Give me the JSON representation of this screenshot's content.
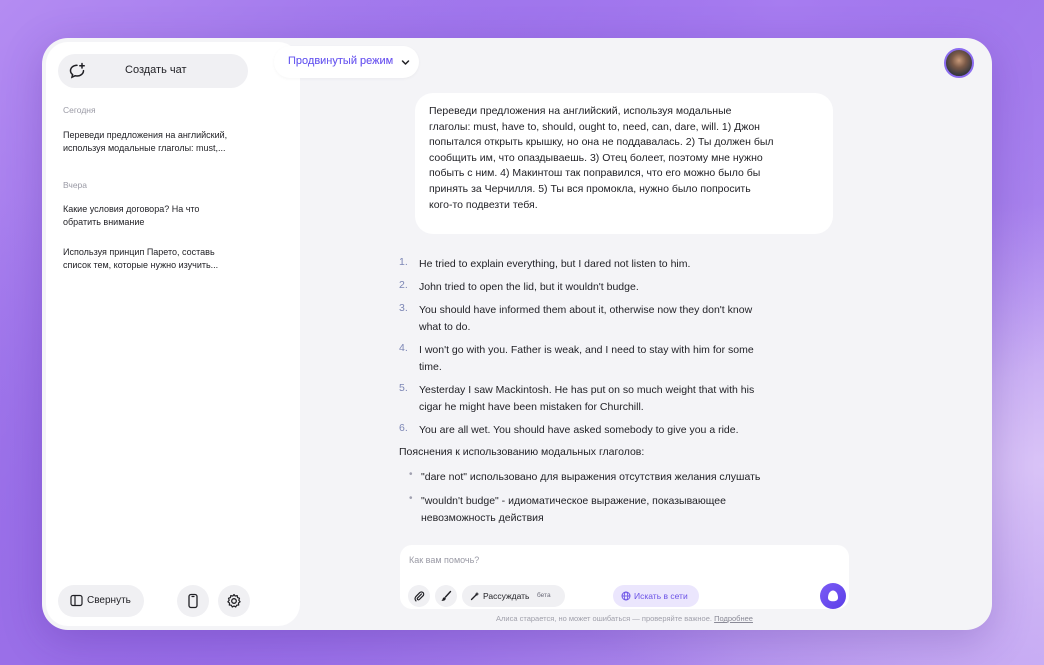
{
  "sidebar": {
    "new_chat_label": "Создать чат",
    "today_label": "Сегодня",
    "yesterday_label": "Вчера",
    "today_items": [
      {
        "line1": "Переведи предложения на английский,",
        "line2": "используя модальные глаголы: must,..."
      }
    ],
    "yesterday_items": [
      {
        "line1": "Какие условия договора? На что",
        "line2": "обратить внимание"
      },
      {
        "line1": "Используя принцип Парето, составь",
        "line2": "список тем, которые нужно изучить..."
      }
    ],
    "collapse_label": "Свернуть"
  },
  "header": {
    "mode_label": "Продвинутый режим"
  },
  "chat": {
    "user_message_lines": [
      "Переведи предложения на английский, используя модальные",
      "глаголы: must, have to, should, ought to, need, can, dare, will. 1) Джон",
      "попытался открыть крышку, но она не поддавалась. 2) Ты должен был",
      "сообщить им, что опаздываешь. 3) Отец болеет, поэтому мне нужно",
      "побыть с ним. 4) Макинтош так поправился, что его можно было бы",
      "принять за Черчилля. 5) Ты вся промокла, нужно было попросить",
      "кого-то подвезти тебя."
    ],
    "answer_list": [
      {
        "num": "1.",
        "line1": "He tried to explain everything, but I dared not listen to him.",
        "line2": ""
      },
      {
        "num": "2.",
        "line1": "John tried to open the lid, but it wouldn't budge.",
        "line2": ""
      },
      {
        "num": "3.",
        "line1": "You should have informed them about it, otherwise now they don't know",
        "line2": "what to do."
      },
      {
        "num": "4.",
        "line1": "I won't go with you. Father is weak, and I need to stay with him for some",
        "line2": "time."
      },
      {
        "num": "5.",
        "line1": "Yesterday I saw Mackintosh. He has put on so much weight that with his",
        "line2": "cigar he might have been mistaken for Churchill."
      },
      {
        "num": "6.",
        "line1": "You are all wet. You should have asked somebody to give you a ride.",
        "line2": ""
      }
    ],
    "explanation_title": "Пояснения к использованию модальных глаголов:",
    "explanation_bullets": [
      {
        "line1": "\"dare not\" использовано для выражения отсутствия желания слушать",
        "line2": ""
      },
      {
        "line1": "\"wouldn't budge\" - идиоматическое выражение, показывающее",
        "line2": "невозможность действия"
      }
    ]
  },
  "input": {
    "placeholder": "Как вам помочь?",
    "reason_label": "Рассуждать",
    "reason_badge": "бета",
    "search_label": "Искать в сети"
  },
  "footer": {
    "disclaimer": "Алиса старается, но может ошибаться — проверяйте важное.",
    "more_link": "Подробнее"
  },
  "colors": {
    "accent": "#6b52e6",
    "window_bg": "#f4f4f7",
    "panel_bg": "#ffffff"
  }
}
